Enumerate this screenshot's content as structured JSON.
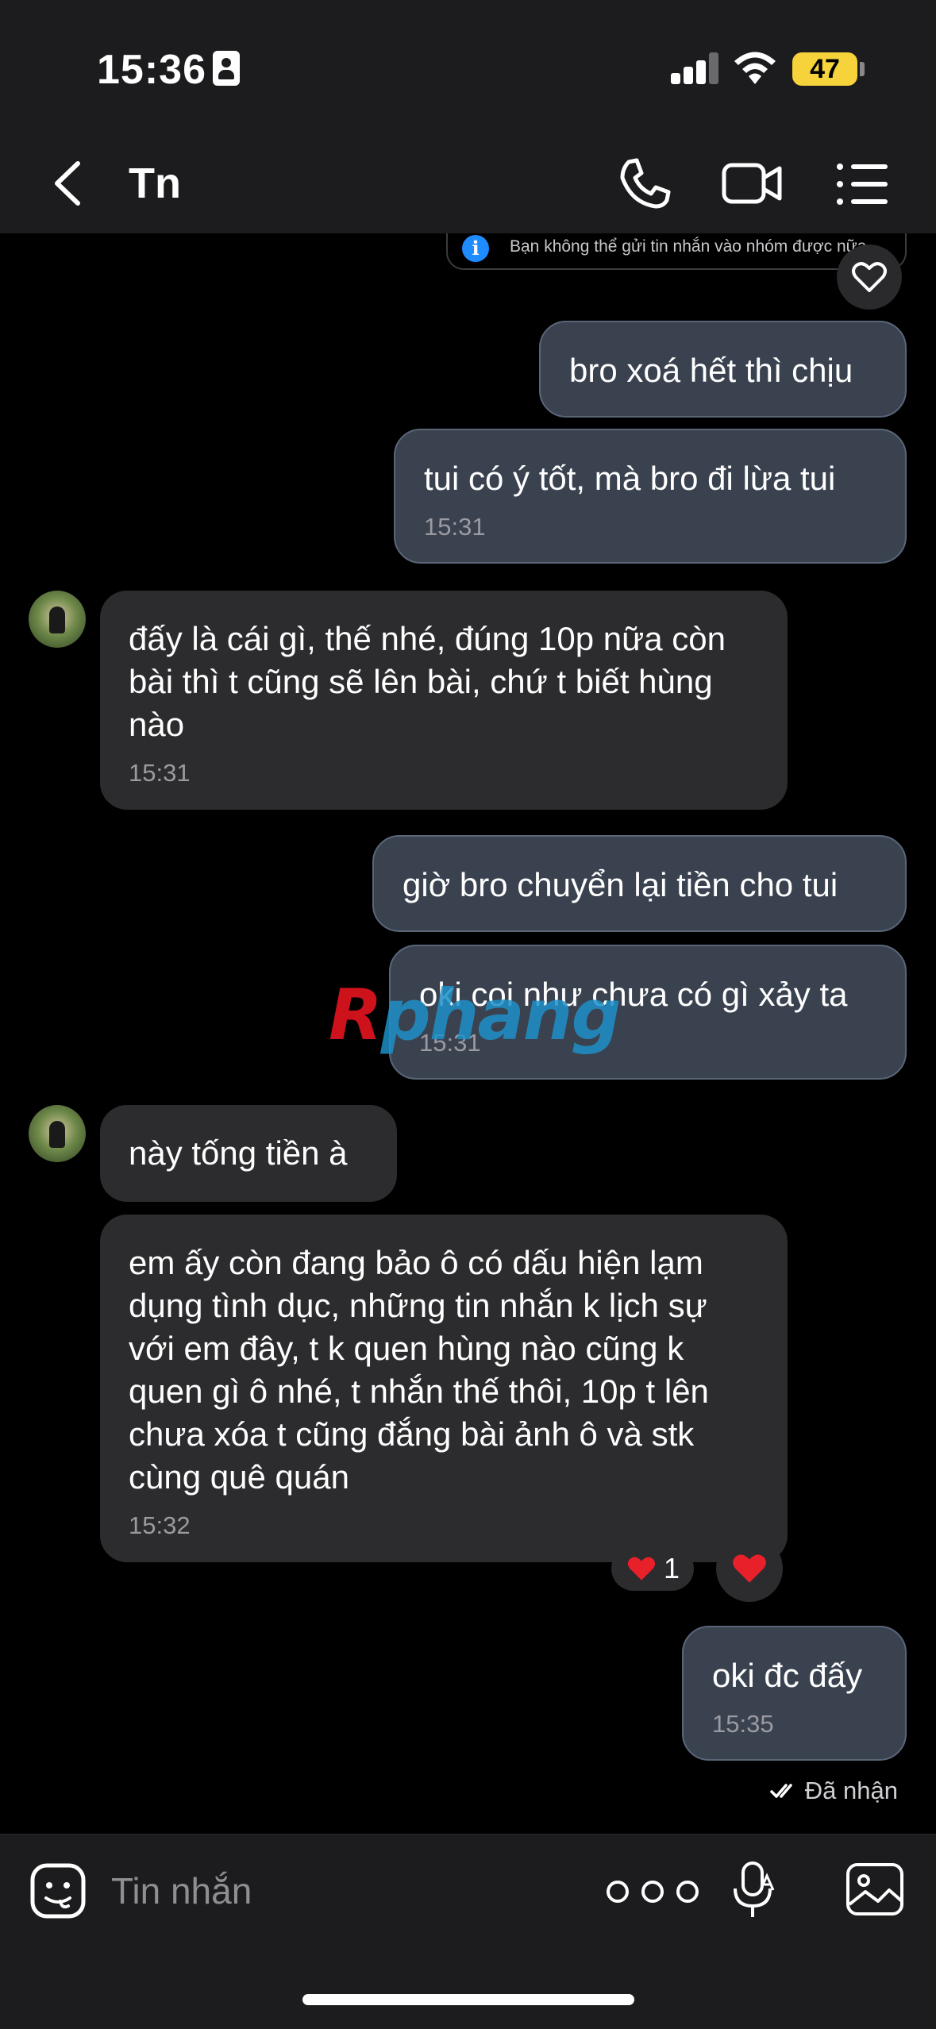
{
  "status_bar": {
    "time": "15:36",
    "battery": "47"
  },
  "header": {
    "title": "Tn"
  },
  "notice": {
    "text": "Bạn không thể gửi tin nhắn vào nhóm được nữa"
  },
  "messages": [
    {
      "dir": "out",
      "text": "bro xoá hết thì chịu",
      "time": ""
    },
    {
      "dir": "out",
      "text": "tui có ý tốt, mà bro đi lừa tui",
      "time": "15:31"
    },
    {
      "dir": "in",
      "text": "đấy là cái gì, thế nhé, đúng 10p nữa còn bài thì t cũng sẽ lên bài, chứ t biết hùng nào",
      "time": "15:31"
    },
    {
      "dir": "out",
      "text": "giờ bro chuyển lại tiền cho tui",
      "time": ""
    },
    {
      "dir": "out",
      "text": "oki coi như chưa có gì xảy ta",
      "time": "15:31"
    },
    {
      "dir": "in",
      "text": "này tống tiền à",
      "time": ""
    },
    {
      "dir": "in",
      "text": "em ấy còn đang bảo ô có dấu hiện lạm dụng tình dục, những tin nhắn k lịch sự với em đây, t k quen hùng nào cũng k quen gì ô nhé, t nhắn thế thôi, 10p t lên chưa xóa t cũng đắng bài ảnh ô và stk cùng quê quán",
      "time": "15:32"
    },
    {
      "dir": "out",
      "text": "oki đc đấy",
      "time": "15:35"
    }
  ],
  "reaction": {
    "emoji": "❤️",
    "count": "1"
  },
  "delivery_status": "Đã nhận",
  "watermark": {
    "part1": "R",
    "part2": "phang"
  },
  "composer": {
    "placeholder": "Tin nhắn"
  }
}
